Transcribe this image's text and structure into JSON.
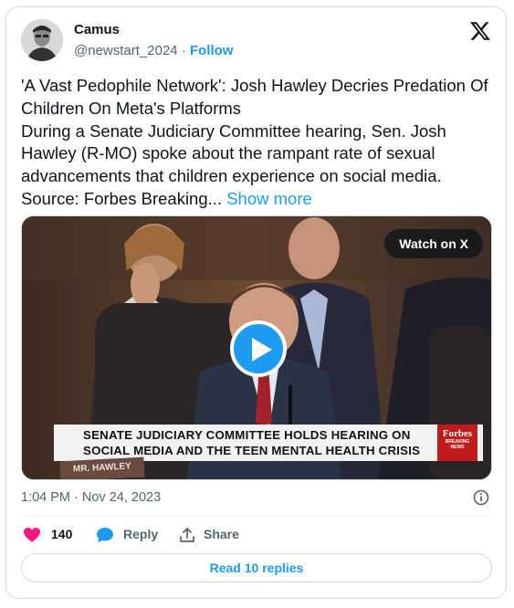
{
  "author": {
    "display_name": "Camus",
    "handle": "@newstart_2024",
    "separator": "·",
    "follow_label": "Follow"
  },
  "tweet": {
    "text": "'A Vast Pedophile Network': Josh Hawley Decries Predation Of Children On Meta's Platforms\nDuring a Senate Judiciary Committee hearing, Sen. Josh Hawley (R-MO) spoke about the rampant rate of sexual advancements that children experience on social media. Source: Forbes Breaking...",
    "show_more": "Show more"
  },
  "media": {
    "watch_label": "Watch on X",
    "chyron_line1": "SENATE JUDICIARY COMMITTEE HOLDS HEARING ON",
    "chyron_line2": "SOCIAL MEDIA AND THE TEEN MENTAL HEALTH CRISIS",
    "forbes_logo": "Forbes",
    "forbes_sub1": "BREAKING",
    "forbes_sub2": "NEWS",
    "nameplate": "MR. HAWLEY"
  },
  "meta": {
    "timestamp": "1:04 PM · Nov 24, 2023"
  },
  "actions": {
    "like_count": "140",
    "reply_label": "Reply",
    "share_label": "Share",
    "read_replies": "Read 10 replies"
  },
  "colors": {
    "accent": "#1d9bf0",
    "like": "#f91880",
    "muted": "#536471"
  },
  "icons": [
    "x-logo-icon",
    "play-icon",
    "info-icon",
    "heart-icon",
    "reply-bubble-icon",
    "share-icon"
  ]
}
